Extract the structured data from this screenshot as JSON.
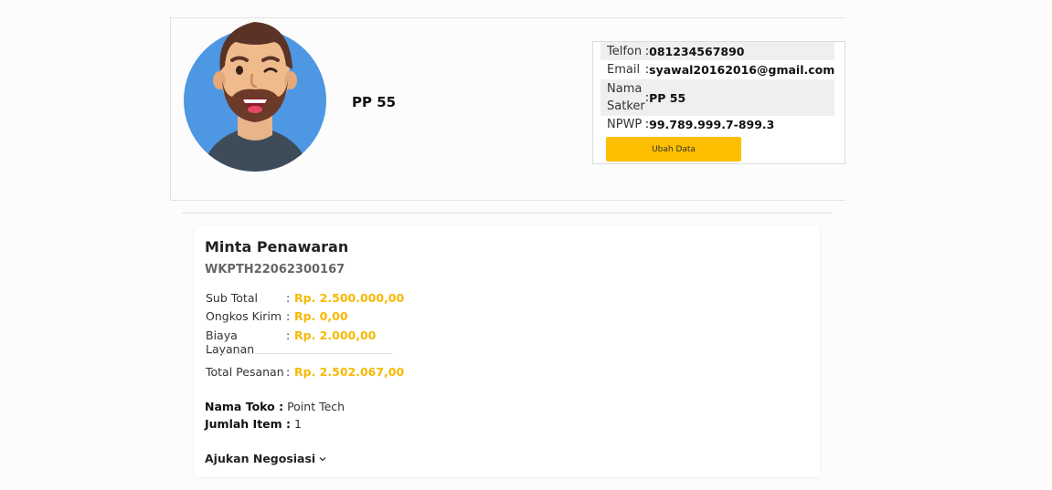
{
  "profile": {
    "name": "PP 55",
    "info": [
      {
        "label": "Telfon",
        "value": "081234567890"
      },
      {
        "label": "Email",
        "value": "syawal20162016@gmail.com"
      },
      {
        "label": "Nama Satker",
        "value": "PP 55"
      },
      {
        "label": "NPWP",
        "value": "99.789.999.7-899.3"
      }
    ],
    "colon": ":",
    "edit_button_label": "Ubah Data"
  },
  "order": {
    "title": "Minta Penawaran",
    "code": "WKPTH22062300167",
    "costs": [
      {
        "label": "Sub Total",
        "value": "Rp. 2.500.000,00"
      },
      {
        "label": "Ongkos Kirim",
        "value": "Rp. 0,00"
      },
      {
        "label": "Biaya Layanan",
        "value": "Rp. 2.000,00"
      }
    ],
    "total": {
      "label": "Total Pesanan",
      "value": "Rp. 2.502.067,00"
    },
    "store": {
      "label": "Nama Toko :",
      "value": "Point Tech"
    },
    "items": {
      "label": "Jumlah Item :",
      "value": "1"
    },
    "negotiate_label": "Ajukan Negosiasi"
  },
  "colors": {
    "accent": "#fdbf00",
    "price": "#f6b900",
    "avatar_bg": "#4e97e3"
  }
}
